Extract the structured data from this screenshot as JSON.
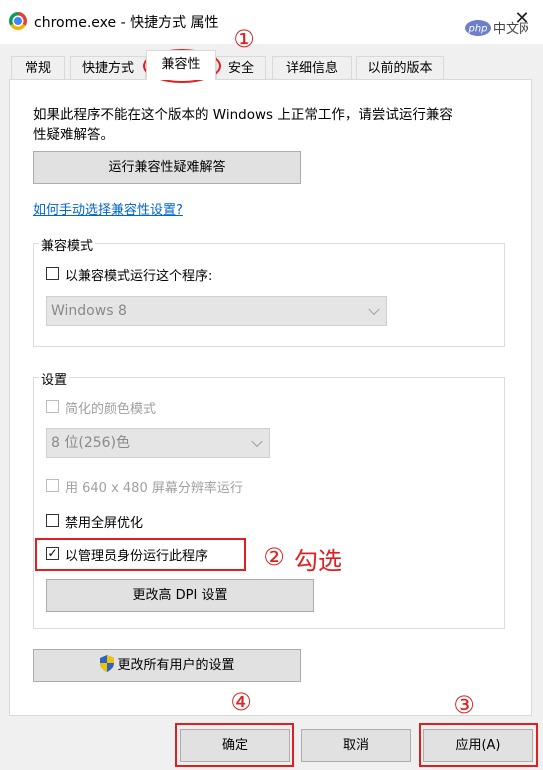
{
  "window": {
    "title": "chrome.exe - 快捷方式 属性",
    "close_glyph": "✕",
    "watermark": "php中文网"
  },
  "tabs": [
    {
      "label": "常规"
    },
    {
      "label": "快捷方式"
    },
    {
      "label": "兼容性",
      "selected": true
    },
    {
      "label": "安全"
    },
    {
      "label": "详细信息"
    },
    {
      "label": "以前的版本"
    }
  ],
  "compat": {
    "intro_line1": "如果此程序不能在这个版本的 Windows 上正常工作，请尝试运行兼容",
    "intro_line2": "性疑难解答。",
    "troubleshoot_button": "运行兼容性疑难解答",
    "manual_link": "如何手动选择兼容性设置?",
    "mode_group_label": "兼容模式",
    "mode_checkbox_label": "以兼容模式运行这个程序:",
    "mode_checkbox_checked": false,
    "mode_select_value": "Windows 8"
  },
  "settings": {
    "group_label": "设置",
    "reduced_color_label": "简化的颜色模式",
    "reduced_color_checked": false,
    "color_select_value": "8 位(256)色",
    "res_640_label": "用 640 x 480 屏幕分辨率运行",
    "res_640_checked": false,
    "disable_fullscreen_label": "禁用全屏优化",
    "disable_fullscreen_checked": false,
    "run_as_admin_label": "以管理员身份运行此程序",
    "run_as_admin_checked": true,
    "dpi_button": "更改高 DPI 设置"
  },
  "all_users_button": "更改所有用户的设置",
  "footer": {
    "ok": "确定",
    "cancel": "取消",
    "apply": "应用(A)"
  },
  "annotations": {
    "step1": "①",
    "step2": "②",
    "step2_text": "勾选",
    "step3": "③",
    "step4": "④",
    "color": "#e02020"
  },
  "icons": {
    "shield": "uac-shield-icon",
    "checkmark": "✓"
  }
}
